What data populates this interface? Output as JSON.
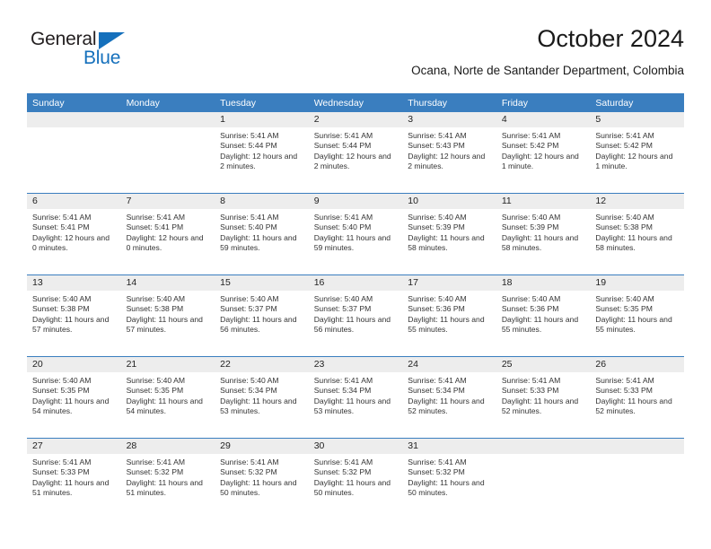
{
  "brand": {
    "name_part1": "General",
    "name_part2": "Blue",
    "color_primary": "#1570bc",
    "color_text": "#231f20"
  },
  "header": {
    "title": "October 2024",
    "subtitle": "Ocana, Norte de Santander Department, Colombia"
  },
  "theme": {
    "header_bg": "#3a7ebf",
    "daynum_bg": "#ededed",
    "rule_color": "#3a7ebf"
  },
  "calendar": {
    "weekday_headers": [
      "Sunday",
      "Monday",
      "Tuesday",
      "Wednesday",
      "Thursday",
      "Friday",
      "Saturday"
    ],
    "weeks": [
      [
        {
          "day": "",
          "empty": true
        },
        {
          "day": "",
          "empty": true
        },
        {
          "day": "1",
          "sunrise": "Sunrise: 5:41 AM",
          "sunset": "Sunset: 5:44 PM",
          "daylight": "Daylight: 12 hours and 2 minutes."
        },
        {
          "day": "2",
          "sunrise": "Sunrise: 5:41 AM",
          "sunset": "Sunset: 5:44 PM",
          "daylight": "Daylight: 12 hours and 2 minutes."
        },
        {
          "day": "3",
          "sunrise": "Sunrise: 5:41 AM",
          "sunset": "Sunset: 5:43 PM",
          "daylight": "Daylight: 12 hours and 2 minutes."
        },
        {
          "day": "4",
          "sunrise": "Sunrise: 5:41 AM",
          "sunset": "Sunset: 5:42 PM",
          "daylight": "Daylight: 12 hours and 1 minute."
        },
        {
          "day": "5",
          "sunrise": "Sunrise: 5:41 AM",
          "sunset": "Sunset: 5:42 PM",
          "daylight": "Daylight: 12 hours and 1 minute."
        }
      ],
      [
        {
          "day": "6",
          "sunrise": "Sunrise: 5:41 AM",
          "sunset": "Sunset: 5:41 PM",
          "daylight": "Daylight: 12 hours and 0 minutes."
        },
        {
          "day": "7",
          "sunrise": "Sunrise: 5:41 AM",
          "sunset": "Sunset: 5:41 PM",
          "daylight": "Daylight: 12 hours and 0 minutes."
        },
        {
          "day": "8",
          "sunrise": "Sunrise: 5:41 AM",
          "sunset": "Sunset: 5:40 PM",
          "daylight": "Daylight: 11 hours and 59 minutes."
        },
        {
          "day": "9",
          "sunrise": "Sunrise: 5:41 AM",
          "sunset": "Sunset: 5:40 PM",
          "daylight": "Daylight: 11 hours and 59 minutes."
        },
        {
          "day": "10",
          "sunrise": "Sunrise: 5:40 AM",
          "sunset": "Sunset: 5:39 PM",
          "daylight": "Daylight: 11 hours and 58 minutes."
        },
        {
          "day": "11",
          "sunrise": "Sunrise: 5:40 AM",
          "sunset": "Sunset: 5:39 PM",
          "daylight": "Daylight: 11 hours and 58 minutes."
        },
        {
          "day": "12",
          "sunrise": "Sunrise: 5:40 AM",
          "sunset": "Sunset: 5:38 PM",
          "daylight": "Daylight: 11 hours and 58 minutes."
        }
      ],
      [
        {
          "day": "13",
          "sunrise": "Sunrise: 5:40 AM",
          "sunset": "Sunset: 5:38 PM",
          "daylight": "Daylight: 11 hours and 57 minutes."
        },
        {
          "day": "14",
          "sunrise": "Sunrise: 5:40 AM",
          "sunset": "Sunset: 5:38 PM",
          "daylight": "Daylight: 11 hours and 57 minutes."
        },
        {
          "day": "15",
          "sunrise": "Sunrise: 5:40 AM",
          "sunset": "Sunset: 5:37 PM",
          "daylight": "Daylight: 11 hours and 56 minutes."
        },
        {
          "day": "16",
          "sunrise": "Sunrise: 5:40 AM",
          "sunset": "Sunset: 5:37 PM",
          "daylight": "Daylight: 11 hours and 56 minutes."
        },
        {
          "day": "17",
          "sunrise": "Sunrise: 5:40 AM",
          "sunset": "Sunset: 5:36 PM",
          "daylight": "Daylight: 11 hours and 55 minutes."
        },
        {
          "day": "18",
          "sunrise": "Sunrise: 5:40 AM",
          "sunset": "Sunset: 5:36 PM",
          "daylight": "Daylight: 11 hours and 55 minutes."
        },
        {
          "day": "19",
          "sunrise": "Sunrise: 5:40 AM",
          "sunset": "Sunset: 5:35 PM",
          "daylight": "Daylight: 11 hours and 55 minutes."
        }
      ],
      [
        {
          "day": "20",
          "sunrise": "Sunrise: 5:40 AM",
          "sunset": "Sunset: 5:35 PM",
          "daylight": "Daylight: 11 hours and 54 minutes."
        },
        {
          "day": "21",
          "sunrise": "Sunrise: 5:40 AM",
          "sunset": "Sunset: 5:35 PM",
          "daylight": "Daylight: 11 hours and 54 minutes."
        },
        {
          "day": "22",
          "sunrise": "Sunrise: 5:40 AM",
          "sunset": "Sunset: 5:34 PM",
          "daylight": "Daylight: 11 hours and 53 minutes."
        },
        {
          "day": "23",
          "sunrise": "Sunrise: 5:41 AM",
          "sunset": "Sunset: 5:34 PM",
          "daylight": "Daylight: 11 hours and 53 minutes."
        },
        {
          "day": "24",
          "sunrise": "Sunrise: 5:41 AM",
          "sunset": "Sunset: 5:34 PM",
          "daylight": "Daylight: 11 hours and 52 minutes."
        },
        {
          "day": "25",
          "sunrise": "Sunrise: 5:41 AM",
          "sunset": "Sunset: 5:33 PM",
          "daylight": "Daylight: 11 hours and 52 minutes."
        },
        {
          "day": "26",
          "sunrise": "Sunrise: 5:41 AM",
          "sunset": "Sunset: 5:33 PM",
          "daylight": "Daylight: 11 hours and 52 minutes."
        }
      ],
      [
        {
          "day": "27",
          "sunrise": "Sunrise: 5:41 AM",
          "sunset": "Sunset: 5:33 PM",
          "daylight": "Daylight: 11 hours and 51 minutes."
        },
        {
          "day": "28",
          "sunrise": "Sunrise: 5:41 AM",
          "sunset": "Sunset: 5:32 PM",
          "daylight": "Daylight: 11 hours and 51 minutes."
        },
        {
          "day": "29",
          "sunrise": "Sunrise: 5:41 AM",
          "sunset": "Sunset: 5:32 PM",
          "daylight": "Daylight: 11 hours and 50 minutes."
        },
        {
          "day": "30",
          "sunrise": "Sunrise: 5:41 AM",
          "sunset": "Sunset: 5:32 PM",
          "daylight": "Daylight: 11 hours and 50 minutes."
        },
        {
          "day": "31",
          "sunrise": "Sunrise: 5:41 AM",
          "sunset": "Sunset: 5:32 PM",
          "daylight": "Daylight: 11 hours and 50 minutes."
        },
        {
          "day": "",
          "empty": true
        },
        {
          "day": "",
          "empty": true
        }
      ]
    ]
  }
}
